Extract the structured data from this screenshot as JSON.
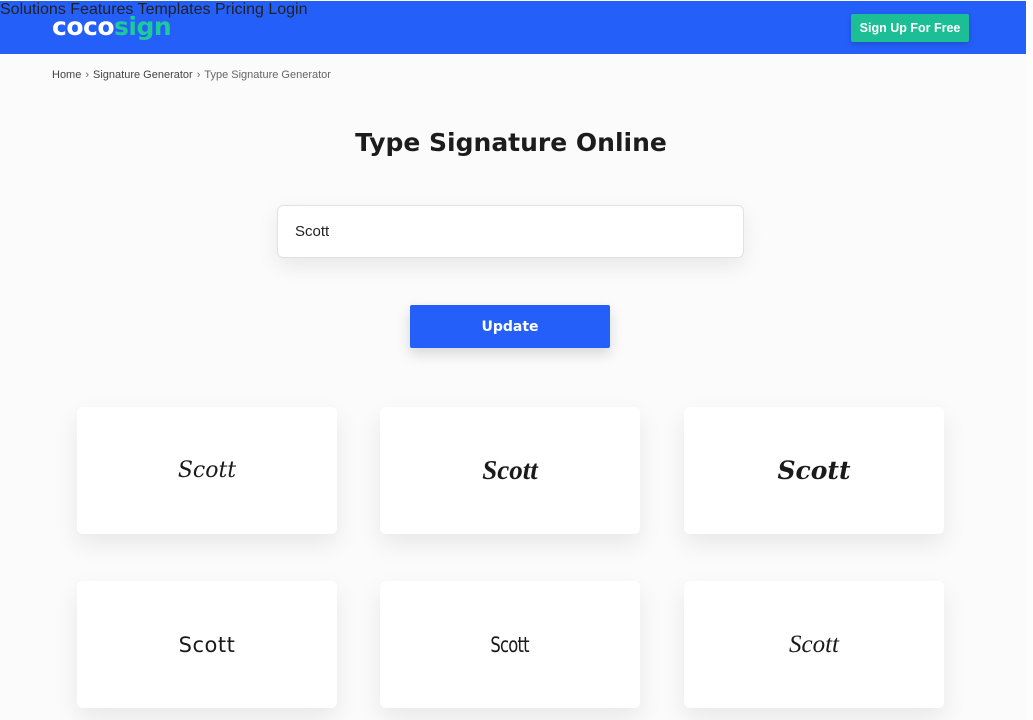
{
  "header": {
    "logo_part1": "coco",
    "logo_part2": "sign",
    "nav": [
      {
        "label": "Solutions"
      },
      {
        "label": "Features"
      },
      {
        "label": "Templates"
      },
      {
        "label": "Pricing"
      },
      {
        "label": "Login"
      }
    ],
    "signup_label": "Sign Up For Free",
    "colors": {
      "header_bg": "#245ffa",
      "accent": "#1cbf95"
    }
  },
  "breadcrumb": {
    "items": [
      "Home",
      "Signature Generator",
      "Type Signature Generator"
    ],
    "separator": "›"
  },
  "main": {
    "title": "Type Signature Online",
    "name_input_value": "Scott",
    "update_label": "Update"
  },
  "signatures": [
    {
      "text": "Scott",
      "style": "script-light"
    },
    {
      "text": "Scott",
      "style": "script-bold"
    },
    {
      "text": "Scott",
      "style": "script-heavy"
    },
    {
      "text": "Scott",
      "style": "handwritten-print"
    },
    {
      "text": "Scott",
      "style": "handwritten-narrow"
    },
    {
      "text": "Scott",
      "style": "script-elegant"
    }
  ]
}
